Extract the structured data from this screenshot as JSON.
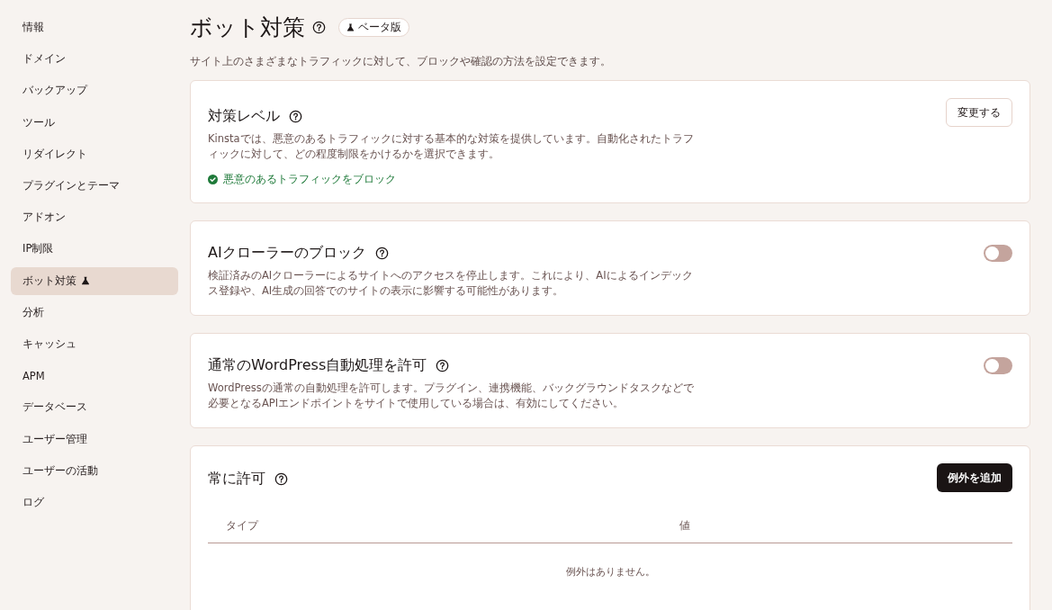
{
  "sidebar": {
    "items": [
      {
        "label": "情報",
        "selected": false,
        "beta": false
      },
      {
        "label": "ドメイン",
        "selected": false,
        "beta": false
      },
      {
        "label": "バックアップ",
        "selected": false,
        "beta": false
      },
      {
        "label": "ツール",
        "selected": false,
        "beta": false
      },
      {
        "label": "リダイレクト",
        "selected": false,
        "beta": false
      },
      {
        "label": "プラグインとテーマ",
        "selected": false,
        "beta": false
      },
      {
        "label": "アドオン",
        "selected": false,
        "beta": false
      },
      {
        "label": "IP制限",
        "selected": false,
        "beta": false
      },
      {
        "label": "ボット対策",
        "selected": true,
        "beta": true
      },
      {
        "label": "分析",
        "selected": false,
        "beta": false
      },
      {
        "label": "キャッシュ",
        "selected": false,
        "beta": false
      },
      {
        "label": "APM",
        "selected": false,
        "beta": false
      },
      {
        "label": "データベース",
        "selected": false,
        "beta": false
      },
      {
        "label": "ユーザー管理",
        "selected": false,
        "beta": false
      },
      {
        "label": "ユーザーの活動",
        "selected": false,
        "beta": false
      },
      {
        "label": "ログ",
        "selected": false,
        "beta": false
      }
    ]
  },
  "header": {
    "title": "ボット対策",
    "badge": "ベータ版",
    "description": "サイト上のさまざまなトラフィックに対して、ブロックや確認の方法を設定できます。"
  },
  "sections": [
    {
      "kind": "level",
      "title": "対策レベル",
      "description": "Kinstaでは、悪意のあるトラフィックに対する基本的な対策を提供しています。自動化されたトラフィックに対して、どの程度制限をかけるかを選択できます。",
      "button": "変更する",
      "status": "悪意のあるトラフィックをブロック"
    },
    {
      "kind": "toggle",
      "title": "AIクローラーのブロック",
      "description": "検証済みのAIクローラーによるサイトへのアクセスを停止します。これにより、AIによるインデックス登録や、AI生成の回答でのサイトの表示に影響する可能性があります。",
      "on": false
    },
    {
      "kind": "toggle",
      "title": "通常のWordPress自動処理を許可",
      "description": "WordPressの通常の自動処理を許可します。プラグイン、連携機能、バックグラウンドタスクなどで必要となるAPIエンドポイントをサイトで使用している場合は、有効にしてください。",
      "on": false
    },
    {
      "kind": "table",
      "title": "常に許可",
      "button": "例外を追加",
      "columns": [
        "タイプ",
        "値"
      ],
      "empty_text": "例外はありません。"
    }
  ]
}
